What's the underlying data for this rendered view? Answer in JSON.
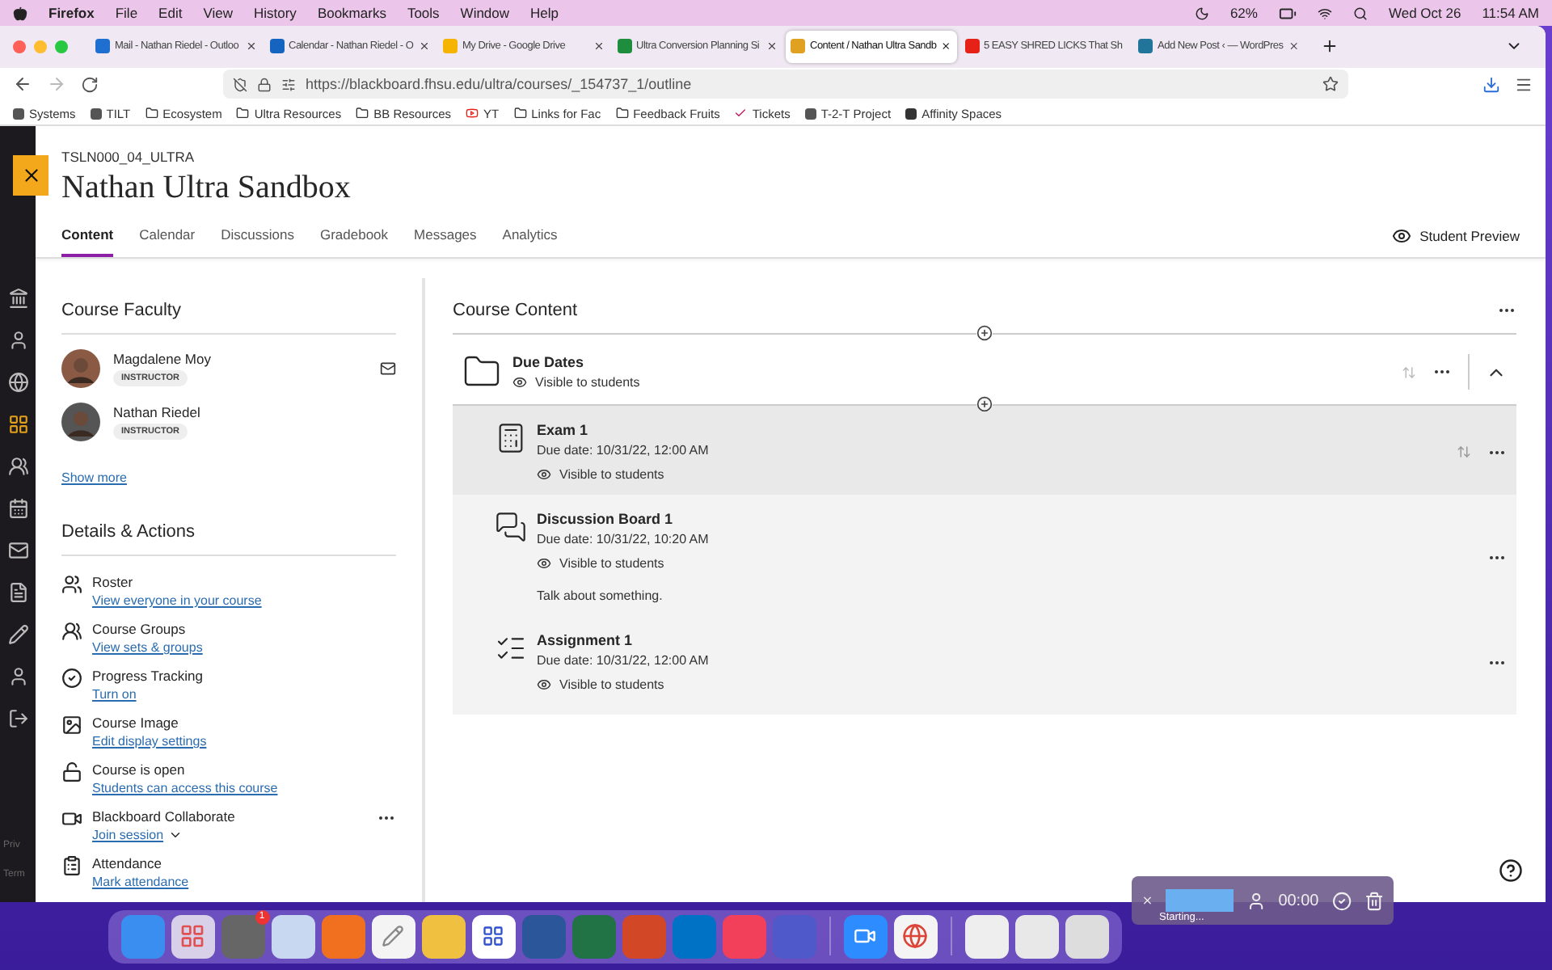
{
  "menubar": {
    "app": "Firefox",
    "menus": [
      "File",
      "Edit",
      "View",
      "History",
      "Bookmarks",
      "Tools",
      "Window",
      "Help"
    ],
    "battery": "62%",
    "date": "Wed Oct 26",
    "time": "11:54 AM"
  },
  "browser": {
    "tabs": [
      {
        "title": "Mail - Nathan Riedel - Outloo",
        "color": "#1f6fd1",
        "selected": false
      },
      {
        "title": "Calendar - Nathan Riedel - O",
        "color": "#1565c0",
        "selected": false
      },
      {
        "title": "My Drive - Google Drive",
        "color": "#f4b400",
        "selected": false
      },
      {
        "title": "Ultra Conversion Planning Si",
        "color": "#1e8e3e",
        "selected": false
      },
      {
        "title": "Content / Nathan Ultra Sandb",
        "color": "#e0a020",
        "selected": true
      },
      {
        "title": "5 EASY SHRED LICKS That Sh",
        "color": "#e62117",
        "selected": false
      },
      {
        "title": "Add New Post ‹ — WordPres",
        "color": "#21759b",
        "selected": false
      }
    ],
    "url": "https://blackboard.fhsu.edu/ultra/courses/_154737_1/outline",
    "bookmarks": [
      {
        "label": "Systems",
        "kind": "site"
      },
      {
        "label": "TILT",
        "kind": "site"
      },
      {
        "label": "Ecosystem",
        "kind": "folder"
      },
      {
        "label": "Ultra Resources",
        "kind": "folder"
      },
      {
        "label": "BB Resources",
        "kind": "folder"
      },
      {
        "label": "YT",
        "kind": "video"
      },
      {
        "label": "Links for Fac",
        "kind": "folder"
      },
      {
        "label": "Feedback Fruits",
        "kind": "folder"
      },
      {
        "label": "Tickets",
        "kind": "check"
      },
      {
        "label": "T-2-T Project",
        "kind": "site"
      },
      {
        "label": "Affinity Spaces",
        "kind": "letter"
      }
    ]
  },
  "course": {
    "code": "TSLN000_04_ULTRA",
    "title": "Nathan Ultra Sandbox",
    "nav": [
      {
        "label": "Content",
        "selected": true
      },
      {
        "label": "Calendar",
        "selected": false
      },
      {
        "label": "Discussions",
        "selected": false
      },
      {
        "label": "Gradebook",
        "selected": false
      },
      {
        "label": "Messages",
        "selected": false
      },
      {
        "label": "Analytics",
        "selected": false
      }
    ],
    "student_preview": "Student Preview"
  },
  "faculty": {
    "heading": "Course Faculty",
    "members": [
      {
        "name": "Magdalene Moy",
        "role": "INSTRUCTOR",
        "email": true
      },
      {
        "name": "Nathan Riedel",
        "role": "INSTRUCTOR",
        "email": false
      }
    ],
    "show_more": "Show more"
  },
  "details": {
    "heading": "Details & Actions",
    "items": [
      {
        "kind": "roster",
        "title": "Roster",
        "link": "View everyone in your course"
      },
      {
        "kind": "groups",
        "title": "Course Groups",
        "link": "View sets & groups"
      },
      {
        "kind": "progress",
        "title": "Progress Tracking",
        "link": "Turn on"
      },
      {
        "kind": "image",
        "title": "Course Image",
        "link": "Edit display settings"
      },
      {
        "kind": "open",
        "title": "Course is open",
        "link": "Students can access this course"
      },
      {
        "kind": "collaborate",
        "title": "Blackboard Collaborate",
        "link": "Join session",
        "dropdown": true
      },
      {
        "kind": "attendance",
        "title": "Attendance",
        "link": "Mark attendance"
      }
    ]
  },
  "content": {
    "heading": "Course Content",
    "folder": {
      "title": "Due Dates",
      "visibility": "Visible to students",
      "expanded": true
    },
    "items": [
      {
        "kind": "exam",
        "title": "Exam 1",
        "due": "Due date: 10/31/22, 12:00 AM",
        "visibility": "Visible to students",
        "hovered": true
      },
      {
        "kind": "discussion",
        "title": "Discussion Board 1",
        "due": "Due date: 10/31/22, 10:20 AM",
        "visibility": "Visible to students",
        "description": "Talk about something.",
        "hovered": false
      },
      {
        "kind": "assignment",
        "title": "Assignment 1",
        "due": "Due date: 10/31/22, 12:00 AM",
        "visibility": "Visible to students",
        "hovered": false
      }
    ]
  },
  "sidebar_footer": [
    "Priv",
    "Term"
  ],
  "dock": {
    "badge": "1"
  },
  "recorder": {
    "time": "00:00",
    "status": "Starting..."
  }
}
